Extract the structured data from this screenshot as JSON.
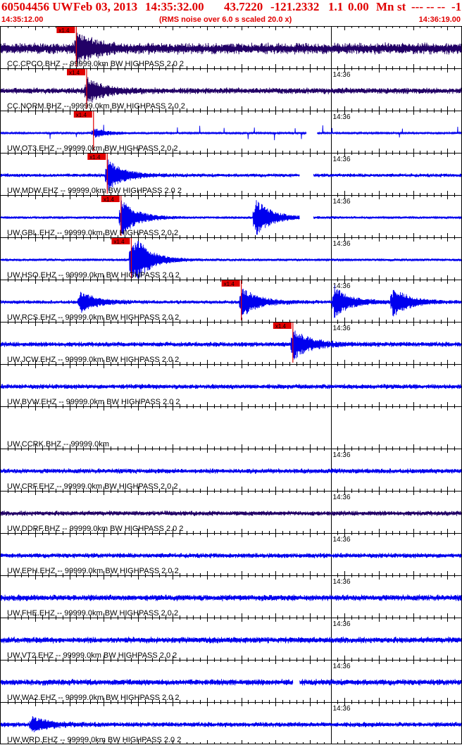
{
  "header": {
    "event_id": "60504456 UW",
    "date": "Feb 03, 2013",
    "time": "14:35:32.00",
    "lat": "43.7220",
    "lon": "-121.2332",
    "mag": "1.1",
    "depth": "0.00",
    "mtype": "Mn",
    "status": "st",
    "tail": "--- -- --",
    "flag": "-1",
    "start_time": "14:35:12.00",
    "rms_note": "(RMS noise over 6.0 s scaled 20.0 x)",
    "end_time": "14:36:19.00"
  },
  "chart_data": {
    "type": "line",
    "time_range_s": [
      0,
      67
    ],
    "minute_tick_label": "14:36",
    "minute_tick_s": 48,
    "pick_label": "x1.4",
    "colors": {
      "trace_blue": "#0000ee",
      "trace_purple": "#220066",
      "accent": "#e00000",
      "grid": "#000000"
    },
    "traces": [
      {
        "label": "CC.CPCO.BHZ -- 99999.0km BW  HIGHPASS  2.0  2",
        "color": "trace_purple",
        "pick_s": 11.0,
        "amp": 9,
        "event_amp": 1.0,
        "show_tick_label": false
      },
      {
        "label": "CC.NORM.BHZ -- 99999.0km BW  HIGHPASS  2.0  2",
        "color": "trace_purple",
        "pick_s": 12.5,
        "amp": 5,
        "event_amp": 0.8,
        "show_tick_label": true
      },
      {
        "label": "UW.OT3.EHZ -- 99999.0km BW  HIGHPASS  2.0  2",
        "color": "trace_blue",
        "pick_s": 13.5,
        "amp": 1.5,
        "event_amp": 0.3,
        "spiky": true,
        "gaps": [
          [
            44.5,
            46.0
          ]
        ],
        "show_tick_label": true
      },
      {
        "label": "UW.MDW.EHZ -- 99999.0km BW  HIGHPASS  2.0  2",
        "color": "trace_blue",
        "pick_s": 15.5,
        "amp": 3,
        "event_amp": 1.0,
        "gaps": [
          [
            43.5,
            45.5
          ]
        ],
        "show_tick_label": true
      },
      {
        "label": "UW.GBL.EHZ -- 99999.0km BW  HIGHPASS  2.0  2",
        "color": "trace_blue",
        "pick_s": 17.5,
        "amp": 2,
        "event_amp": 1.2,
        "gaps": [
          [
            43.5,
            45.5
          ]
        ],
        "extra_bursts": [
          [
            37.0,
            1.3
          ]
        ],
        "show_tick_label": true
      },
      {
        "label": "UW.HSO.EHZ -- 99999.0km BW  HIGHPASS  2.0  2",
        "color": "trace_blue",
        "pick_s": 19.0,
        "amp": 2,
        "event_amp": 2.0,
        "show_tick_label": true
      },
      {
        "label": "UW.RCS.EHZ -- 99999.0km BW  HIGHPASS  2.0  2",
        "color": "trace_blue",
        "pick_s": 35.0,
        "amp": 3,
        "event_amp": 1.0,
        "extra_bursts": [
          [
            11.5,
            0.7
          ],
          [
            48.5,
            1.0
          ],
          [
            57.0,
            1.0
          ]
        ],
        "show_tick_label": true
      },
      {
        "label": "UW.JCW.EHZ -- 99999.0km BW  HIGHPASS  2.0  2",
        "color": "trace_blue",
        "pick_s": 42.5,
        "amp": 4,
        "event_amp": 1.0,
        "show_tick_label": true
      },
      {
        "label": "UW.BVW.EHZ -- 99999.0km BW  HIGHPASS  2.0  2",
        "color": "trace_blue",
        "amp": 4,
        "show_tick_label": false
      },
      {
        "label": "UW.CCRK.BHZ -- 99999.0km",
        "color": "trace_blue",
        "amp": 0,
        "show_tick_label": false
      },
      {
        "label": "UW.CRF.EHZ -- 99999.0km BW  HIGHPASS  2.0  2",
        "color": "trace_blue",
        "amp": 4,
        "show_tick_label": true
      },
      {
        "label": "UW.DDRF.BHZ -- 99999.0km BW  HIGHPASS  2.0  2",
        "color": "trace_purple",
        "amp": 4,
        "show_tick_label": true
      },
      {
        "label": "UW.EPH.EHZ -- 99999.0km BW  HIGHPASS  2.0  2",
        "color": "trace_blue",
        "amp": 4,
        "show_tick_label": true
      },
      {
        "label": "UW.FHE.EHZ -- 99999.0km BW  HIGHPASS  2.0  2",
        "color": "trace_blue",
        "amp": 5,
        "show_tick_label": true
      },
      {
        "label": "UW.VT2.EHZ -- 99999.0km BW  HIGHPASS  2.0  2",
        "color": "trace_blue",
        "amp": 5,
        "show_tick_label": true
      },
      {
        "label": "UW.WA2.EHZ -- 99999.0km BW  HIGHPASS  2.0  2",
        "color": "trace_blue",
        "amp": 5,
        "gaps": [
          [
            42.5,
            43.5
          ]
        ],
        "show_tick_label": true
      },
      {
        "label": "UW.WRD.EHZ -- 99999.0km BW  HIGHPASS  2.0  2",
        "color": "trace_blue",
        "amp": 4,
        "extra_bursts": [
          [
            4.5,
            0.5
          ]
        ],
        "show_tick_label": true
      }
    ]
  }
}
